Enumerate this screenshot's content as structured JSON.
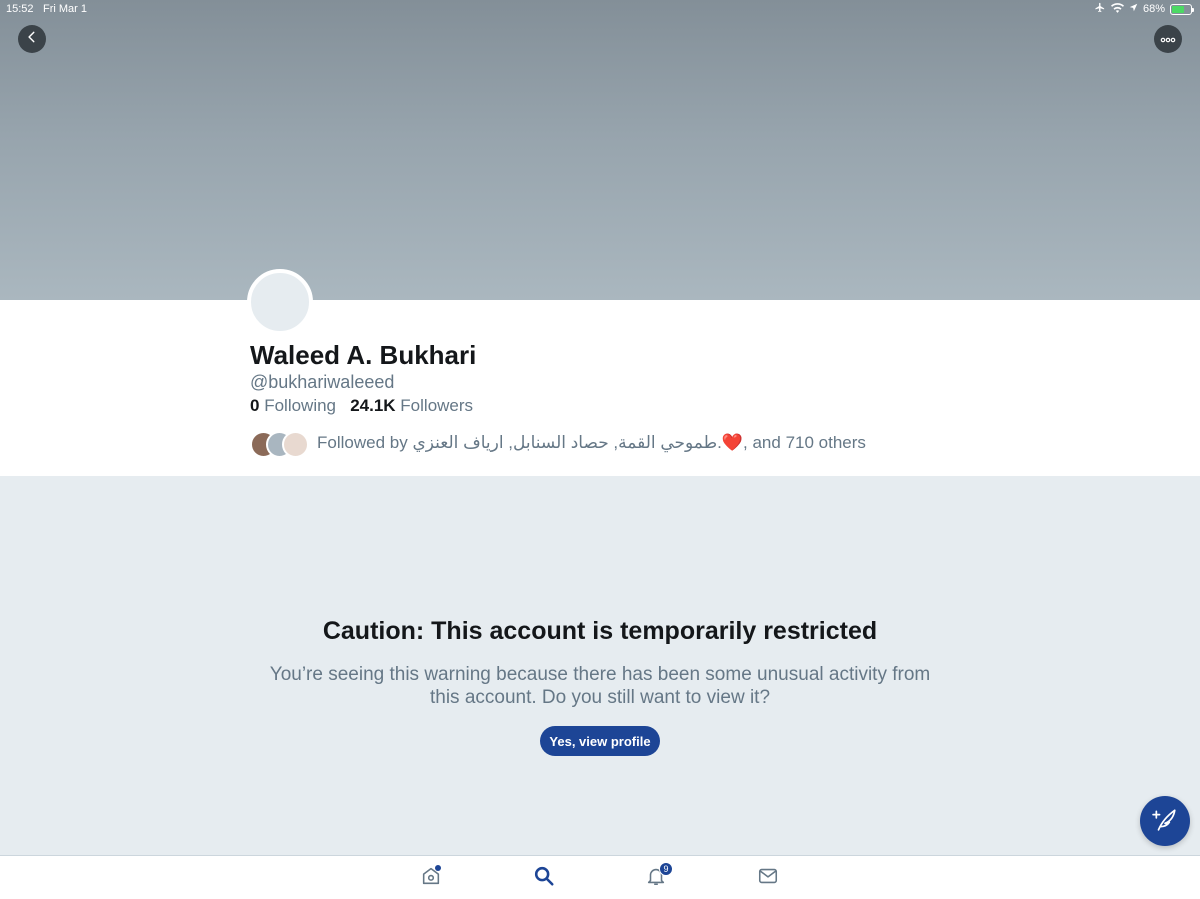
{
  "status_bar": {
    "time": "15:52",
    "date": "Fri Mar 1",
    "battery_percent": "68%",
    "battery_level": 0.68
  },
  "profile": {
    "display_name": "Waleed A. Bukhari",
    "handle": "@bukhariwaleeed",
    "following_count": "0",
    "following_label": "Following",
    "followers_count": "24.1K",
    "followers_label": "Followers",
    "followed_by_text": "Followed by طموحي القمة, حصاد السنابل, ارياف العنزي.❤️, and 710 others"
  },
  "caution": {
    "title": "Caution: This account is temporarily restricted",
    "message": "You’re seeing this warning because there has been some unusual activity from this account. Do you still want to view it?",
    "button_label": "Yes, view profile"
  },
  "tab_bar": {
    "notifications_badge": "9",
    "tabs": [
      "home-icon",
      "search-icon",
      "bell-icon",
      "mail-icon"
    ]
  },
  "colors": {
    "accent": "#1d4596",
    "background": "#e6ecf0",
    "secondary_text": "#657786"
  }
}
